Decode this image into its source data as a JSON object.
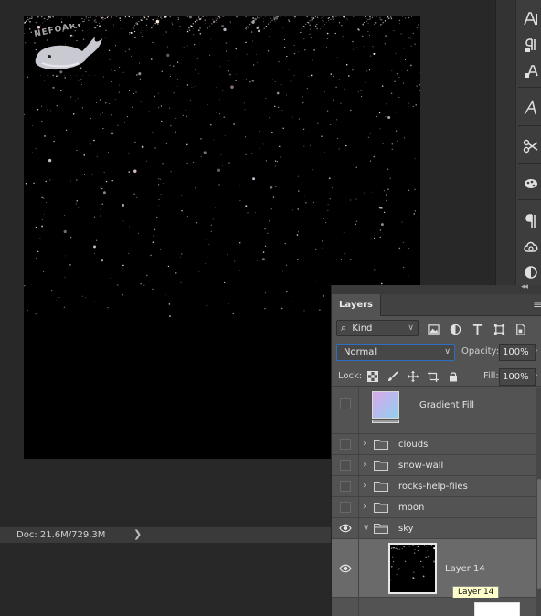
{
  "status_bar": {
    "doc_info": "Doc: 21.6M/729.3M",
    "menu_arrow": "❯"
  },
  "right_toolbar": {
    "tools": [
      "character-icon",
      "paragraph-style-icon",
      "character-style-icon",
      "glyph-icon",
      "tool-presets-icon",
      "3d-icon",
      "paragraph-icon",
      "libraries-icon",
      "adjustments-icon"
    ]
  },
  "layers_panel": {
    "collapse_glyph": "◂◂",
    "tab_label": "Layers",
    "menu_glyph": "≡",
    "filter": {
      "kind_label": "Kind",
      "search_glyph": "⌕",
      "chevron": "∨"
    },
    "blend_mode": "Normal",
    "blend_chevron": "∨",
    "opacity_label": "Opacity:",
    "opacity_value": "100%",
    "lock_label": "Lock:",
    "fill_label": "Fill:",
    "fill_value": "100%",
    "field_chevron": "›",
    "layers": [
      {
        "name": "Gradient Fill",
        "visible": false,
        "type": "fill"
      },
      {
        "name": "clouds",
        "visible": false,
        "type": "group",
        "expand_glyph": "›"
      },
      {
        "name": "snow-wall",
        "visible": false,
        "type": "group",
        "expand_glyph": "›"
      },
      {
        "name": "rocks-help-files",
        "visible": false,
        "type": "group",
        "expand_glyph": "›"
      },
      {
        "name": "moon",
        "visible": false,
        "type": "group",
        "expand_glyph": "›"
      },
      {
        "name": "sky",
        "visible": true,
        "type": "group-open",
        "expand_glyph": "∨"
      },
      {
        "name": "Layer 14",
        "visible": true,
        "type": "pixel"
      }
    ],
    "tooltip": "Layer 14"
  },
  "colors": {
    "workspace": "#282828",
    "panel": "#535353",
    "selected_row": "#6a6a6a",
    "blend_focus": "#2a6fc5",
    "tooltip_bg": "#fdfec9"
  }
}
